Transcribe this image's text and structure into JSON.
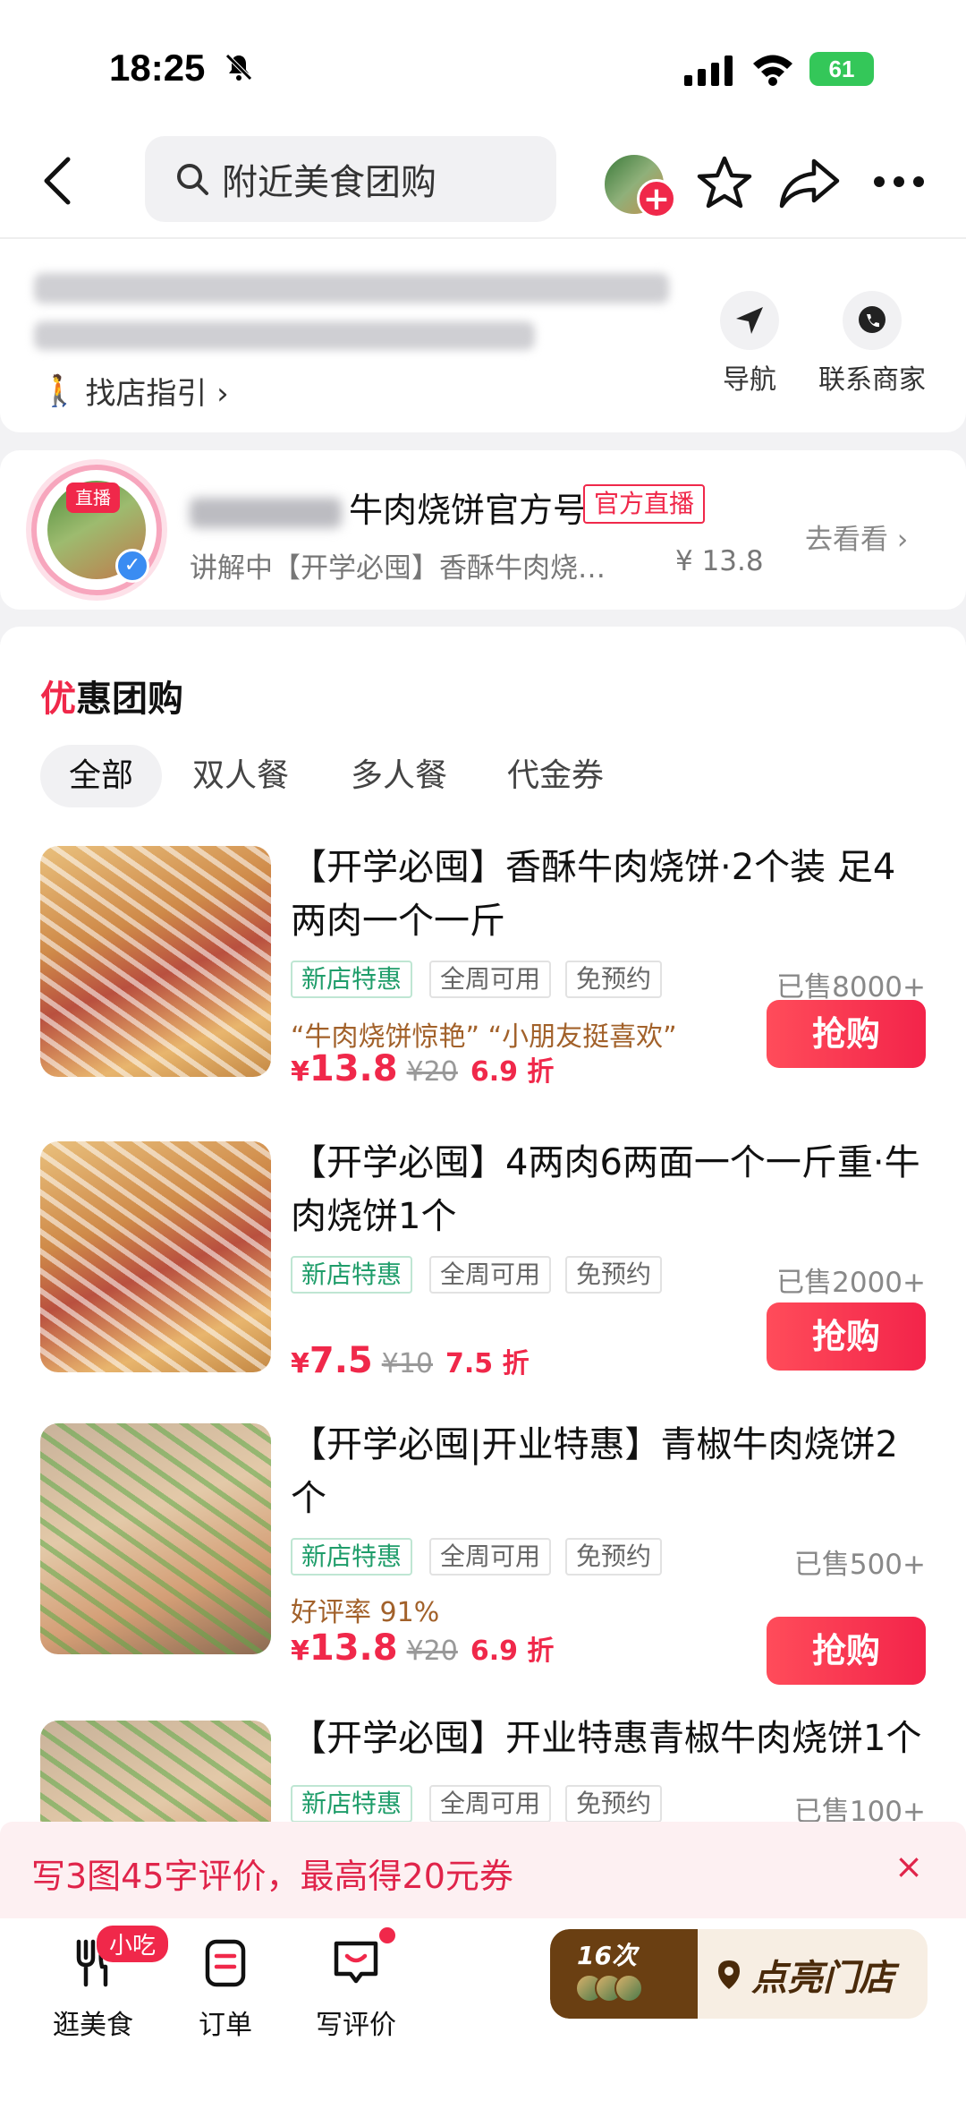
{
  "status_bar": {
    "time": "18:25",
    "battery": "61"
  },
  "header": {
    "search_placeholder": "附近美食团购",
    "add_label": "+"
  },
  "address": {
    "guide_label": "找店指引 ›",
    "nav_label": "导航",
    "contact_label": "联系商家"
  },
  "live": {
    "tag": "直播",
    "name": "牛肉烧饼官方号",
    "badge": "官方直播",
    "desc": "讲解中【开学必囤】香酥牛肉烧…",
    "price": "¥ 13.8",
    "go": "去看看 ›"
  },
  "deals": {
    "title_first": "优",
    "title_rest": "惠团购",
    "tabs": [
      "全部",
      "双人餐",
      "多人餐",
      "代金券"
    ],
    "items": [
      {
        "title": "【开学必囤】香酥牛肉烧饼·2个装 足4两肉一个一斤",
        "tags": [
          "新店特惠",
          "全周可用",
          "免预约"
        ],
        "sold": "已售8000+",
        "quote": "“牛肉烧饼惊艳” “小朋友挺喜欢”",
        "yen": "¥",
        "price": "13.8",
        "orig": "¥20",
        "discount": "6.9 折",
        "buy": "抢购"
      },
      {
        "title": "【开学必囤】4两肉6两面一个一斤重·牛肉烧饼1个",
        "tags": [
          "新店特惠",
          "全周可用",
          "免预约"
        ],
        "sold": "已售2000+",
        "quote": "",
        "yen": "¥",
        "price": "7.5",
        "orig": "¥10",
        "discount": "7.5 折",
        "buy": "抢购"
      },
      {
        "title": "【开学必囤|开业特惠】青椒牛肉烧饼2个",
        "tags": [
          "新店特惠",
          "全周可用",
          "免预约"
        ],
        "sold": "已售500+",
        "quote": "好评率 91%",
        "yen": "¥",
        "price": "13.8",
        "orig": "¥20",
        "discount": "6.9 折",
        "buy": "抢购"
      },
      {
        "title": "【开学必囤】开业特惠青椒牛肉烧饼1个",
        "tags": [
          "新店特惠",
          "全周可用",
          "免预约"
        ],
        "sold": "已售100+"
      }
    ]
  },
  "review_banner": {
    "text": "写3图45字评价，最高得20元券",
    "close": "×"
  },
  "bottom_nav": {
    "items": [
      {
        "label": "逛美食",
        "icon": "fork-knife-icon"
      },
      {
        "label": "订单",
        "icon": "order-icon"
      },
      {
        "label": "写评价",
        "icon": "review-icon"
      }
    ],
    "food_badge": "小吃",
    "light_count": "16次",
    "light_label": "点亮门店"
  },
  "colors": {
    "accent": "#f0284a",
    "green_tag": "#1f9d6a",
    "brown": "#6a3f12"
  }
}
